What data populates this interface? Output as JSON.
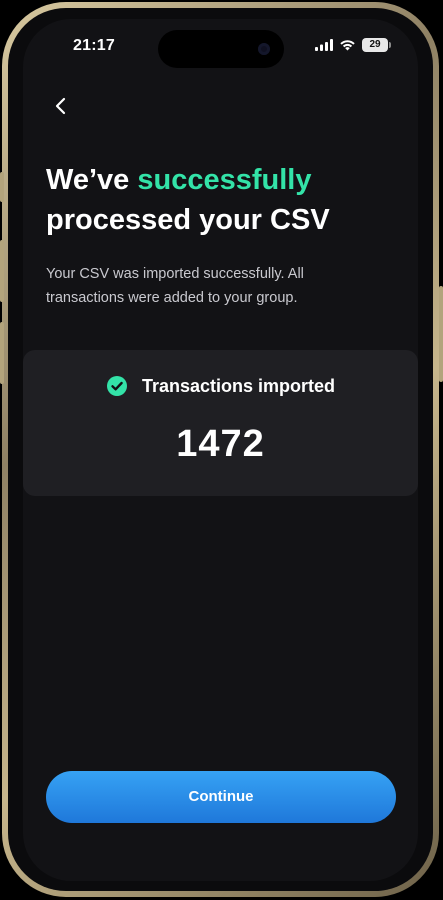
{
  "status_bar": {
    "time": "21:17",
    "battery": "29"
  },
  "header": {
    "title_prefix": "We’ve ",
    "title_accent": "successfully",
    "title_rest": "processed your CSV"
  },
  "description": "Your CSV was imported successfully. All transactions were added to your group.",
  "result": {
    "label": "Transactions imported",
    "value": "1472"
  },
  "actions": {
    "continue_label": "Continue"
  },
  "colors": {
    "accent": "#33e3a8",
    "button": "#2a8ce8",
    "background": "#121215",
    "card": "#1f1f23"
  },
  "icons": [
    "back-icon",
    "check-circle-icon",
    "signal-icon",
    "wifi-icon",
    "battery-icon"
  ]
}
